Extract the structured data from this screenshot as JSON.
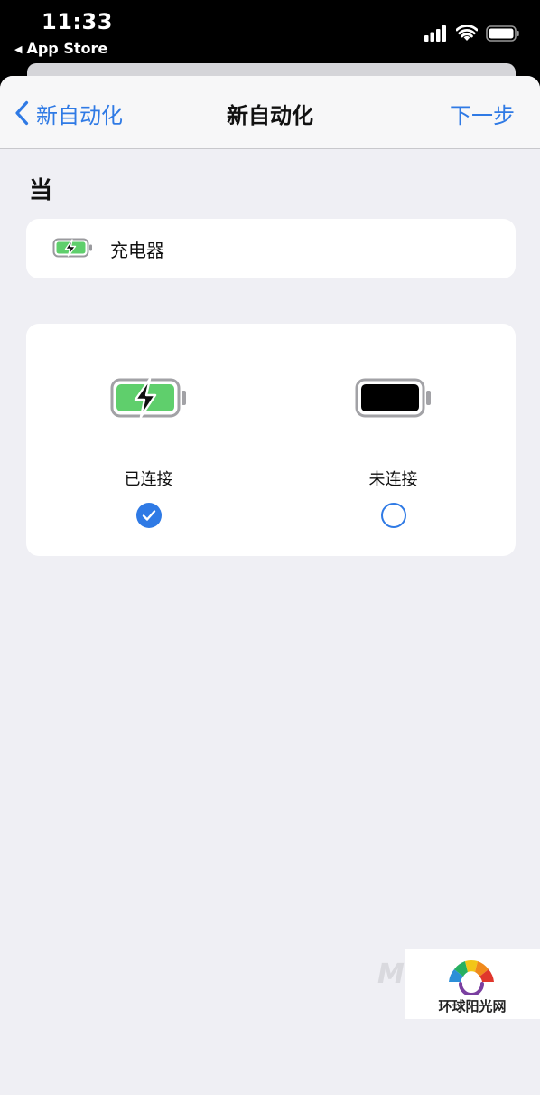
{
  "status_bar": {
    "time": "11:33",
    "back_app": "App Store",
    "icons": [
      "cellular-signal-icon",
      "wifi-icon",
      "battery-icon"
    ]
  },
  "navbar": {
    "back_label": "新自动化",
    "title": "新自动化",
    "next_label": "下一步"
  },
  "section": {
    "label": "当"
  },
  "trigger": {
    "label": "充电器",
    "icon": "charging-battery-icon"
  },
  "options": [
    {
      "label": "已连接",
      "icon": "charging-battery-icon",
      "selected": true
    },
    {
      "label": "未连接",
      "icon": "battery-icon",
      "selected": false
    }
  ],
  "watermark": {
    "text": "环球阳光网",
    "faint_mark": "M"
  },
  "colors": {
    "accent": "#2f7ae5",
    "battery_green": "#5fcf6c",
    "background": "#efeff4"
  }
}
